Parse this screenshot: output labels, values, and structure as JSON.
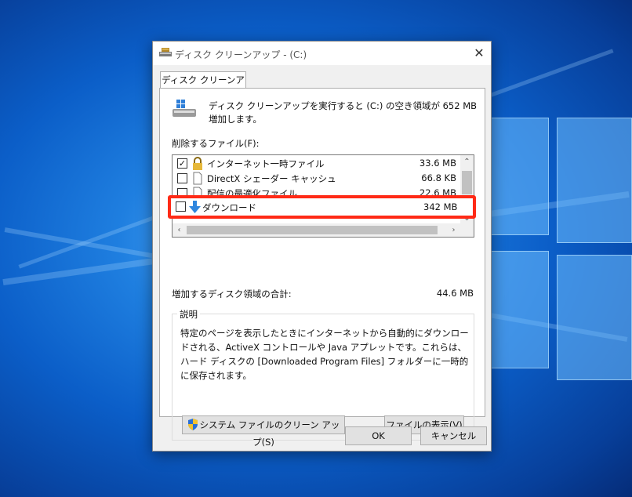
{
  "window": {
    "title": "ディスク クリーンアップ - (C:)",
    "close_glyph": "✕"
  },
  "tab": {
    "label": "ディスク クリーンアップ"
  },
  "header": {
    "text": "ディスク クリーンアップを実行すると (C:) の空き領域が 652 MB 増加します。"
  },
  "files": {
    "label": "削除するファイル(F):",
    "items": [
      {
        "name": "インターネット一時ファイル",
        "size": "33.6 MB",
        "checked": true,
        "icon": "lock-icon"
      },
      {
        "name": "DirectX シェーダー キャッシュ",
        "size": "66.8 KB",
        "checked": false,
        "icon": "file-icon"
      },
      {
        "name": "配信の最適化ファイル",
        "size": "22.6 MB",
        "checked": false,
        "icon": "file-icon"
      },
      {
        "name": "ダウンロード",
        "size": "342 MB",
        "checked": false,
        "icon": "download-arrow-icon"
      }
    ]
  },
  "scroll": {
    "up": "⌃",
    "down": "⌄",
    "left": "‹",
    "right": "›"
  },
  "total": {
    "label": "増加するディスク領域の合計:",
    "value": "44.6 MB"
  },
  "description": {
    "title": "説明",
    "text": "特定のページを表示したときにインターネットから自動的にダウンロードされる、ActiveX コントロールや Java アプレットです。これらは、ハード ディスクの [Downloaded Program Files] フォルダーに一時的に保存されます。"
  },
  "buttons": {
    "system_cleanup": "システム ファイルのクリーン アップ(S)",
    "view_files": "ファイルの表示(V)",
    "ok": "OK",
    "cancel": "キャンセル"
  },
  "colors": {
    "highlight": "#ff2a16",
    "desktop": "#0b5ec8"
  }
}
